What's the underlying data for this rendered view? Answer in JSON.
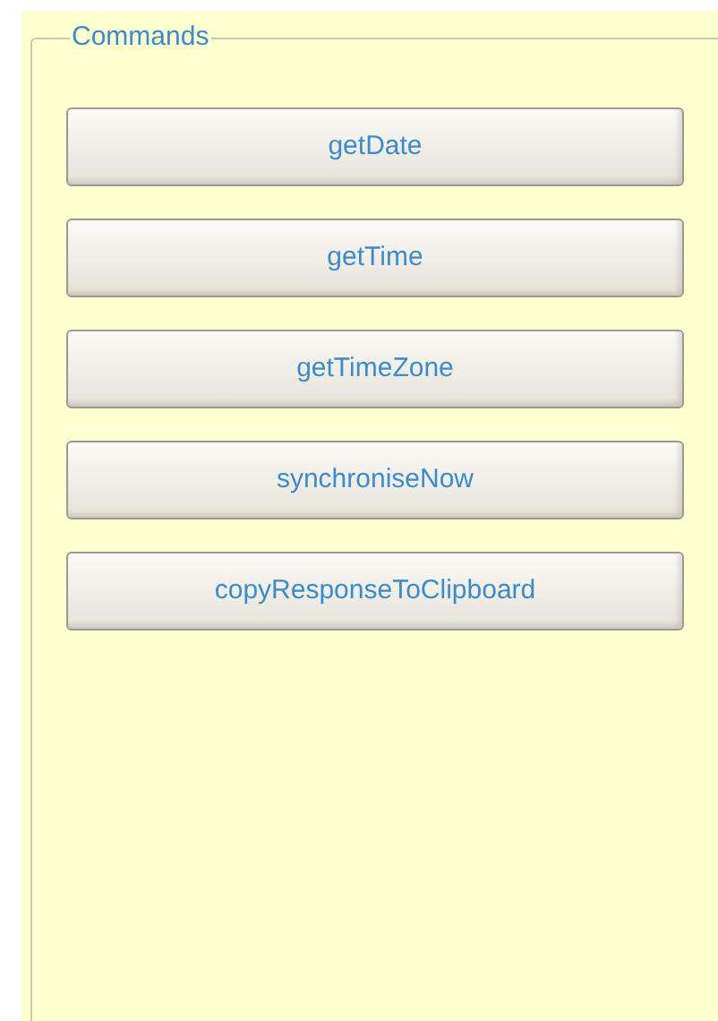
{
  "group": {
    "title": "Commands"
  },
  "buttons": [
    {
      "label": "getDate"
    },
    {
      "label": "getTime"
    },
    {
      "label": "getTimeZone"
    },
    {
      "label": "synchroniseNow"
    },
    {
      "label": "copyResponseToClipboard"
    }
  ]
}
